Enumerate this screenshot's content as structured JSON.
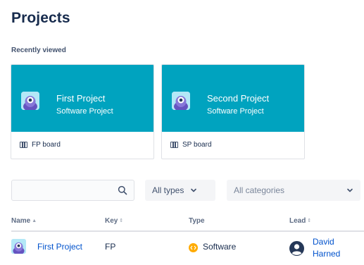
{
  "page": {
    "title": "Projects"
  },
  "recent": {
    "label": "Recently viewed",
    "cards": [
      {
        "name": "First Project",
        "type": "Software Project",
        "board": "FP board",
        "avatar": "project-avatar-icon"
      },
      {
        "name": "Second Project",
        "type": "Software Project",
        "board": "SP board",
        "avatar": "project-avatar-icon"
      }
    ]
  },
  "filters": {
    "search_value": "",
    "search_placeholder": "",
    "types": "All types",
    "categories": "All categories"
  },
  "table": {
    "columns": [
      "Name",
      "Key",
      "Type",
      "Lead"
    ],
    "sorted_column": "Name",
    "rows": [
      {
        "name": "First Project",
        "key": "FP",
        "type": "Software",
        "lead": "David Harned"
      }
    ]
  },
  "icons": {
    "search": "search-icon",
    "chevron": "chevron-down-icon",
    "board": "board-icon",
    "software_type": "software-type-icon",
    "lead": "user-avatar-icon"
  },
  "colors": {
    "card_header": "#00a3bf",
    "link": "#0052cc",
    "text": "#172b4d",
    "software_badge": "#ffab00"
  }
}
